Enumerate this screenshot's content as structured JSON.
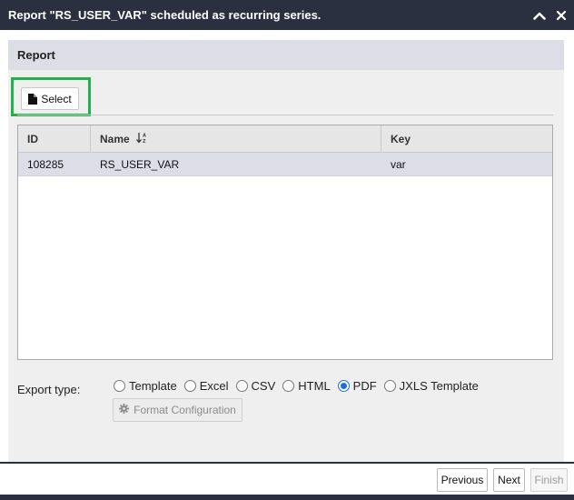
{
  "window": {
    "title": "Report \"RS_USER_VAR\" scheduled as recurring series.",
    "collapse_icon": "chevron-up-icon",
    "close_icon": "close-icon"
  },
  "panel": {
    "header": "Report",
    "select_button": {
      "label": "Select",
      "icon": "document-icon"
    }
  },
  "table": {
    "columns": [
      "ID",
      "Name",
      "Key"
    ],
    "sort_icon": "sort-alpha-down-icon",
    "rows": [
      {
        "id": "108285",
        "name": "RS_USER_VAR",
        "key": "var"
      }
    ]
  },
  "export": {
    "label": "Export type:",
    "options": [
      "Template",
      "Excel",
      "CSV",
      "HTML",
      "PDF",
      "JXLS Template"
    ],
    "selected": "PDF",
    "format_button": {
      "label": "Format Configuration",
      "icon": "gear-icon"
    }
  },
  "footer": {
    "previous": "Previous",
    "next": "Next",
    "finish": "Finish"
  },
  "colors": {
    "titlebar": "#2b3040",
    "panel_header": "#dcdde6",
    "highlight": "#22b24c",
    "radio_selected": "#1a6fe0"
  }
}
